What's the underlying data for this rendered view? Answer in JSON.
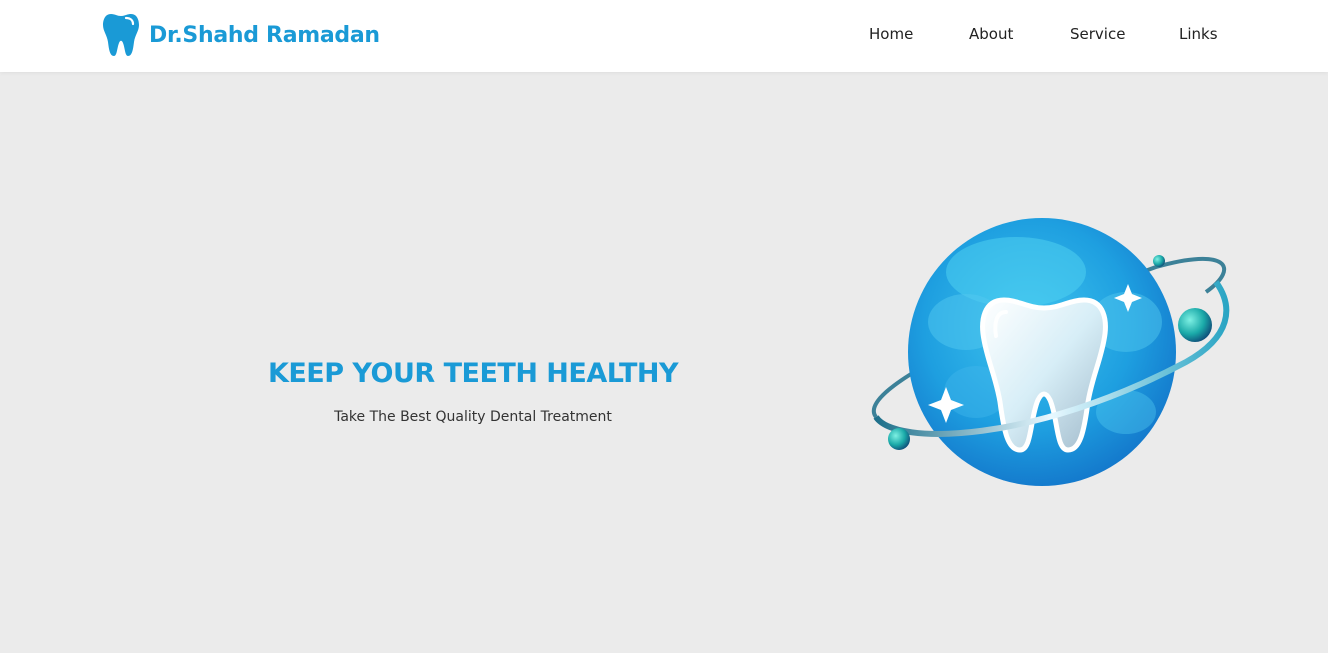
{
  "header": {
    "brand_name": "Dr.Shahd Ramadan",
    "logo_icon": "tooth-icon"
  },
  "nav": {
    "items": [
      {
        "label": "Home"
      },
      {
        "label": "About"
      },
      {
        "label": "Service"
      },
      {
        "label": "Links"
      }
    ]
  },
  "hero": {
    "title": "KEEP YOUR TEETH HEALTHY",
    "subtitle": "Take The Best Quality Dental Treatment",
    "illustration": "tooth-planet-illustration"
  },
  "colors": {
    "brand": "#1a9ad6",
    "background": "#ebebeb",
    "header_bg": "#ffffff",
    "text": "#222222"
  }
}
